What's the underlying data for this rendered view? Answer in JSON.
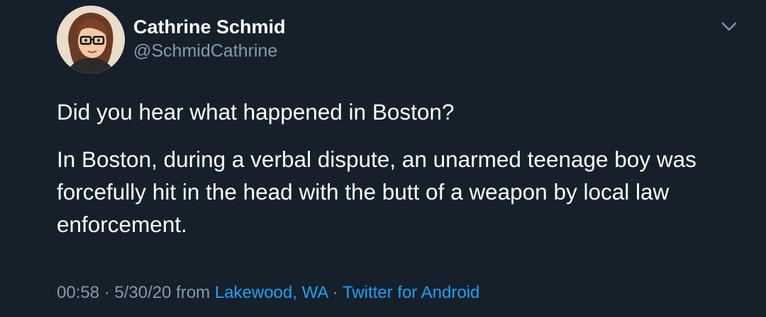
{
  "author": {
    "display_name": "Cathrine Schmid",
    "handle": "@SchmidCathrine"
  },
  "tweet": {
    "paragraphs": [
      "Did you hear what happened in Boston?",
      "In Boston, during a verbal dispute, an unarmed teenage boy was forcefully hit in the head with the butt of a weapon by local law enforcement."
    ],
    "time": "00:58",
    "date": "5/30/20",
    "from_label": "from",
    "location": "Lakewood, WA",
    "separator": "·",
    "source": "Twitter for Android"
  },
  "icons": {
    "avatar": "cartoon-avatar-icon",
    "menu": "chevron-down-icon"
  },
  "colors": {
    "background": "#15202b",
    "primary_text": "#ffffff",
    "secondary_text": "#8899a6",
    "link": "#1da1f2"
  }
}
